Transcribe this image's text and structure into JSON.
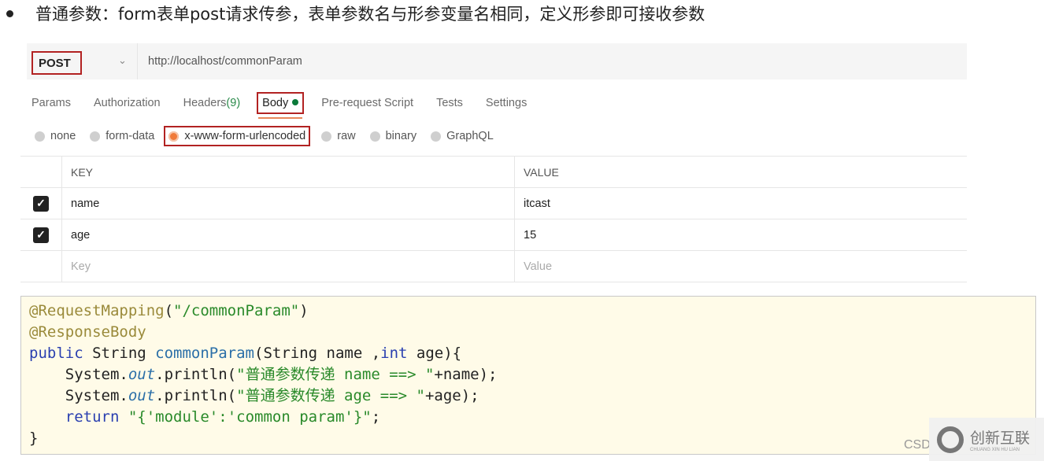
{
  "heading": "普通参数：form表单post请求传参，表单参数名与形参变量名相同，定义形参即可接收参数",
  "request": {
    "method": "POST",
    "url": "http://localhost/commonParam"
  },
  "tabs": [
    {
      "label": "Params"
    },
    {
      "label": "Authorization"
    },
    {
      "label": "Headers",
      "count": "(9)"
    },
    {
      "label": "Body",
      "active": true
    },
    {
      "label": "Pre-request Script"
    },
    {
      "label": "Tests"
    },
    {
      "label": "Settings"
    }
  ],
  "body_types": [
    "none",
    "form-data",
    "x-www-form-urlencoded",
    "raw",
    "binary",
    "GraphQL"
  ],
  "selected_body_type": "x-www-form-urlencoded",
  "table": {
    "key_header": "KEY",
    "value_header": "VALUE",
    "rows": [
      {
        "key": "name",
        "value": "itcast",
        "checked": true
      },
      {
        "key": "age",
        "value": "15",
        "checked": true
      }
    ],
    "key_placeholder": "Key",
    "value_placeholder": "Value"
  },
  "code": [
    [
      [
        "ann",
        "@RequestMapping"
      ],
      [
        "pl",
        "("
      ],
      [
        "str",
        "\"/commonParam\""
      ],
      [
        "pl",
        ")"
      ]
    ],
    [
      [
        "ann",
        "@ResponseBody"
      ]
    ],
    [
      [
        "kw",
        "public"
      ],
      [
        "pl",
        " String "
      ],
      [
        "fn",
        "commonParam"
      ],
      [
        "pl",
        "(String name ,"
      ],
      [
        "kw",
        "int"
      ],
      [
        "pl",
        " age){"
      ]
    ],
    [
      [
        "pl",
        "    System."
      ],
      [
        "it",
        "out"
      ],
      [
        "pl",
        ".println("
      ],
      [
        "str",
        "\"普通参数传递 name ==> \""
      ],
      [
        "pl",
        "+name);"
      ]
    ],
    [
      [
        "pl",
        "    System."
      ],
      [
        "it",
        "out"
      ],
      [
        "pl",
        ".println("
      ],
      [
        "str",
        "\"普通参数传递 age ==> \""
      ],
      [
        "pl",
        "+age);"
      ]
    ],
    [
      [
        "pl",
        "    "
      ],
      [
        "kw",
        "return"
      ],
      [
        "pl",
        " "
      ],
      [
        "str",
        "\"{'module':'common param'}\""
      ],
      [
        "pl",
        ";"
      ]
    ],
    [
      [
        "pl",
        "}"
      ]
    ]
  ],
  "watermark": {
    "csdn": "CSD",
    "brand": "创新互联",
    "brand_sub": "CHUANG XIN HU LIAN"
  }
}
